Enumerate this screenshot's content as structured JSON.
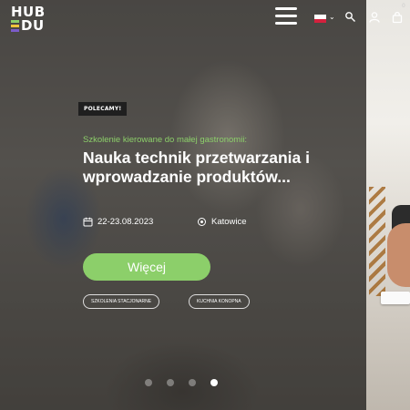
{
  "header": {
    "logo": {
      "top_text": "HUB",
      "bottom_text": "DU",
      "bar_colors": [
        "#8ccf6a",
        "#f0c43c",
        "#7b5cc9"
      ]
    },
    "menu_icon": "hamburger-icon",
    "language": {
      "flag": "pl",
      "caret": "⌄"
    },
    "icons": [
      "search-icon",
      "user-icon",
      "cart-icon"
    ],
    "cart_count": "0"
  },
  "hero": {
    "badge": "POLECAMY!",
    "subtitle": "Szkolenie kierowane do małej gastronomii:",
    "title": "Nauka technik przetwarzania i wprowadzanie produktów...",
    "date": "22-23.08.2023",
    "location": "Katowice",
    "cta_label": "Więcej",
    "tags": [
      "SZKOLENIA STACJONARNE",
      "KUCHNIA KONOPNA"
    ],
    "accent_color": "#8ccf6a"
  },
  "carousel": {
    "slide_count": 4,
    "active_index": 4
  }
}
